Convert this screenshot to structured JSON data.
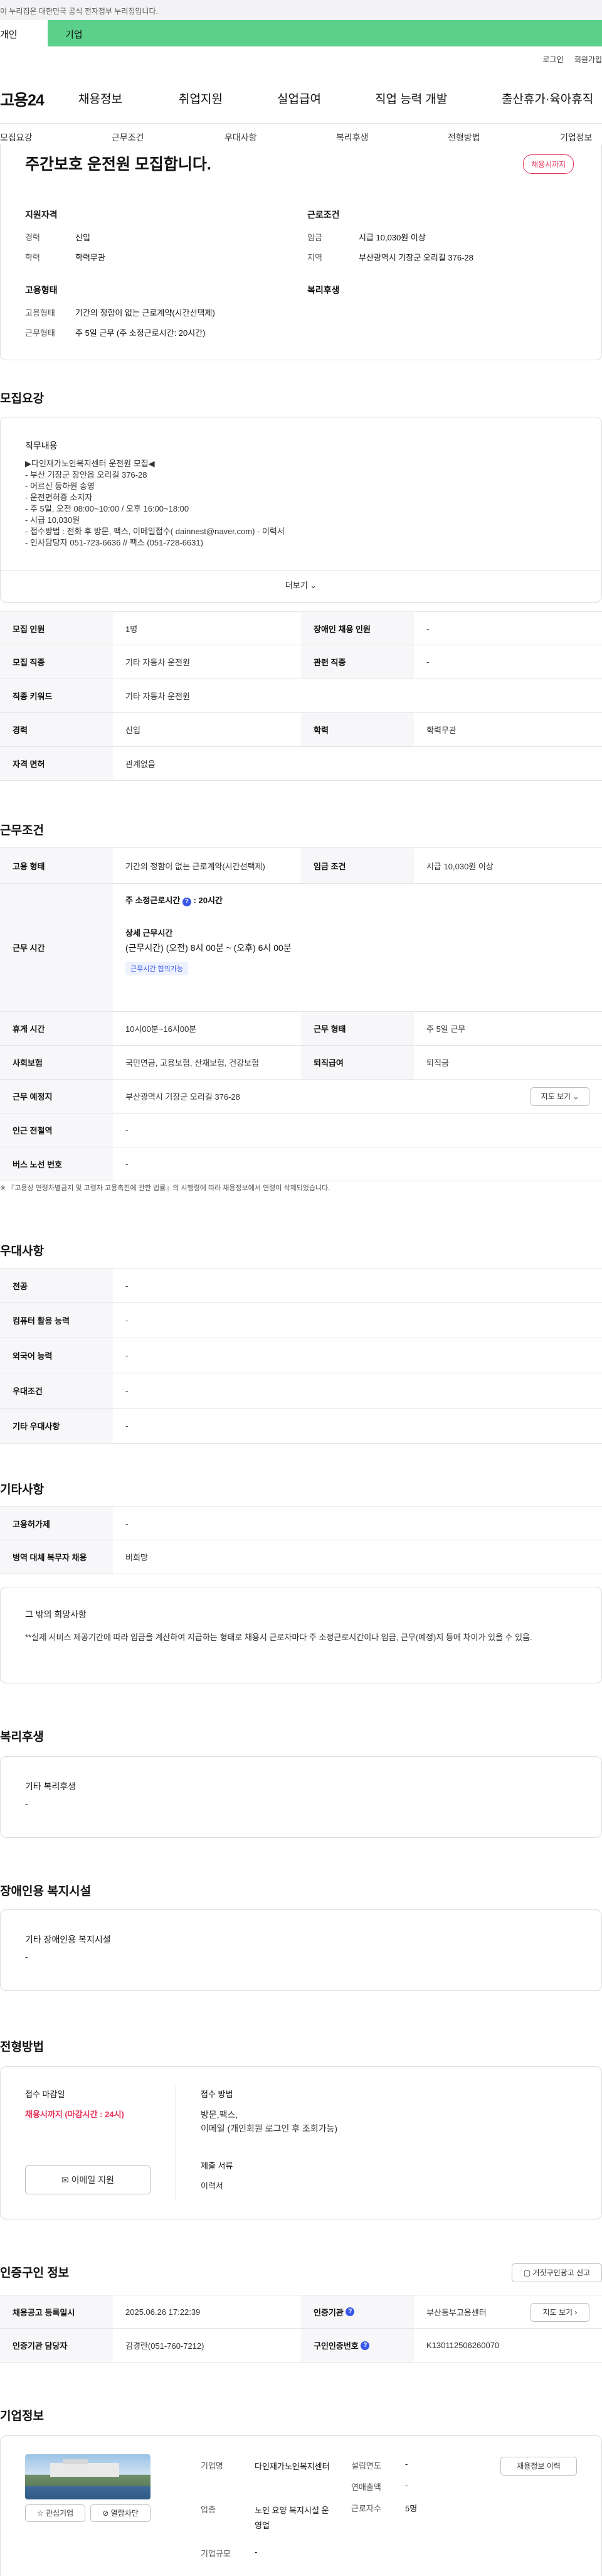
{
  "gov_banner": "이 누리집은 대한민국 공식 전자정부 누리집입니다.",
  "top_tabs": {
    "individual": "개인",
    "corporate": "기업"
  },
  "util": {
    "login": "로그인",
    "join": "회원가입"
  },
  "gnb": {
    "logo": "고용24",
    "menu": [
      "채용정보",
      "취업지원",
      "실업급여",
      "직업 능력 개발",
      "출산휴가·육아휴직"
    ]
  },
  "subnav": [
    "모집요강",
    "근무조건",
    "우대사항",
    "복리후생",
    "전형방법",
    "기업정보"
  ],
  "summary": {
    "title": "주간보호 운전원 모집합니다.",
    "deadline_badge": "채용시까지",
    "qual_title": "지원자격",
    "career_label": "경력",
    "career_value": "신입",
    "edu_label": "학력",
    "edu_value": "학력무관",
    "cond_title": "근로조건",
    "wage_label": "임금",
    "wage_value": "시급 10,030원 이상",
    "region_label": "지역",
    "region_value": "부산광역시 기장군 오리길 376-28",
    "emp_title": "고용형태",
    "emp_label": "고용형태",
    "emp_value": "기간의 정함이 없는 근로계약(시간선택제)",
    "work_label": "근무형태",
    "work_value": "주 5일 근무 (주 소정근로시간: 20시간)",
    "welfare_title": "복리후생"
  },
  "recruit": {
    "section_title": "모집요강",
    "duty_title": "직무내용",
    "duty_text": "▶다인재가노인복지센터 운전원 모집◀\n- 부산 기장군 장안읍 오리길 376-28\n- 어르신 등하원 송영\n- 운전면허증 소지자\n- 주 5일, 오전 08:00~10:00 / 오후 16:00~18:00\n- 시급 10,030원\n- 접수방법 : 전화 후 방문, 팩스, 이메일접수( dainnest@naver.com) - 이력서\n- 인사담당자 051-723-6636 // 팩스 (051-728-6631)",
    "more_label": "더보기",
    "rows": [
      {
        "k1": "모집 인원",
        "v1": "1명",
        "k2": "장애인 채용 인원",
        "v2": "-"
      },
      {
        "k1": "모집 직종",
        "v1": "기타 자동차 운전원",
        "k2": "관련 직종",
        "v2": "-"
      },
      {
        "k1": "직종 키워드",
        "v1": "기타 자동차 운전원",
        "k2": "",
        "v2": ""
      },
      {
        "k1": "경력",
        "v1": "신입",
        "k2": "학력",
        "v2": "학력무관"
      },
      {
        "k1": "자격 면허",
        "v1": "관계없음",
        "k2": "",
        "v2": ""
      }
    ]
  },
  "conditions": {
    "section_title": "근무조건",
    "emp_type_label": "고용 형태",
    "emp_type_value": "기간의 정함이 없는 근로계약(시간선택제)",
    "wage_label": "임금 조건",
    "wage_value": "시급 10,030원 이상",
    "hours_label": "근무 시간",
    "weekly_hours": "주 소정근로시간",
    "weekly_hours_value": "20시간",
    "detail_title": "상세 근무시간",
    "detail_text": "(근무시간) (오전) 8시 00분 ~ (오후) 6시 00분",
    "chip": "근무시간 협의가능",
    "break_label": "휴게 시간",
    "break_value": "10시00분~16시00분",
    "shift_label": "근무 형태",
    "shift_value": "주 5일 근무",
    "insurance_label": "사회보험",
    "insurance_value": "국민연금, 고용보험, 산재보험, 건강보험",
    "retire_label": "퇴직급여",
    "retire_value": "퇴직금",
    "place_label": "근무 예정지",
    "place_value": "부산광역시 기장군 오리길 376-28",
    "map_btn": "지도 보기",
    "subway_label": "인근 전철역",
    "subway_value": "-",
    "bus_label": "버스 노선 번호",
    "bus_value": "-",
    "note": "※ 『고용상 연령차별금지 및 고령자 고용촉진에 관한 법률』의 시행령에 따라 채용정보에서 연령이 삭제되었습니다."
  },
  "preference": {
    "section_title": "우대사항",
    "rows": [
      {
        "k": "전공",
        "v": "-"
      },
      {
        "k": "컴퓨터 활용 능력",
        "v": "-"
      },
      {
        "k": "외국어 능력",
        "v": "-"
      },
      {
        "k": "우대조건",
        "v": "-"
      },
      {
        "k": "기타 우대사항",
        "v": "-"
      }
    ]
  },
  "etc": {
    "section_title": "기타사항",
    "rows": [
      {
        "k": "고용허가제",
        "v": "-"
      },
      {
        "k": "병역 대체 복무자 채용",
        "v": "비희망"
      }
    ],
    "other_title": "그 밖의 희망사항",
    "other_text": "**실제 서비스 제공기간에 따라 임금을 계산하여  지급하는 형태로 채용시 근로자마다 주 소정근로시간이나 임금, 근무(예정)지 등에 차이가 있을 수 있음."
  },
  "welfare": {
    "section_title": "복리후생",
    "box_title": "기타 복리후생",
    "box_value": "-"
  },
  "disabled": {
    "section_title": "장애인용 복지시설",
    "box_title": "기타 장애인용 복지시설",
    "box_value": "-"
  },
  "selection": {
    "section_title": "전형방법",
    "deadline_label": "접수 마감일",
    "deadline_value": "채용시까지 (마감시간 : 24시)",
    "apply_btn": "이메일 지원",
    "method_label": "접수 방법",
    "method_value": "방문,팩스,\n이메일 (개인회원 로그인 후 조회가능)",
    "docs_label": "제출 서류",
    "docs_value": "이력서"
  },
  "cert": {
    "section_title": "인증구인 정보",
    "report_btn": "거짓구인광고 신고",
    "reg_label": "채용공고 등록일시",
    "reg_value": "2025.06.26 17:22:39",
    "org_label": "인증기관",
    "org_value": "부산동부고용센터",
    "map_btn": "지도 보기",
    "manager_label": "인증기관 담당자",
    "manager_value": "김경란(051-760-7212)",
    "cert_no_label": "구인인증번호",
    "cert_no_value": "K130112506260070"
  },
  "company": {
    "section_title": "기업정보",
    "fav_btn": "관심기업",
    "block_btn": "열람차단",
    "name_label": "기업명",
    "name_value": "다인재가노인복지센터",
    "industry_label": "업종",
    "industry_value": "노인 요양 복지시설 운영업",
    "size_label": "기업규모",
    "size_value": "-",
    "founded_label": "설립연도",
    "founded_value": "-",
    "revenue_label": "연매출액",
    "revenue_value": "-",
    "employees_label": "근로자수",
    "employees_value": "5명",
    "list_btn": "채용정보 이력"
  }
}
